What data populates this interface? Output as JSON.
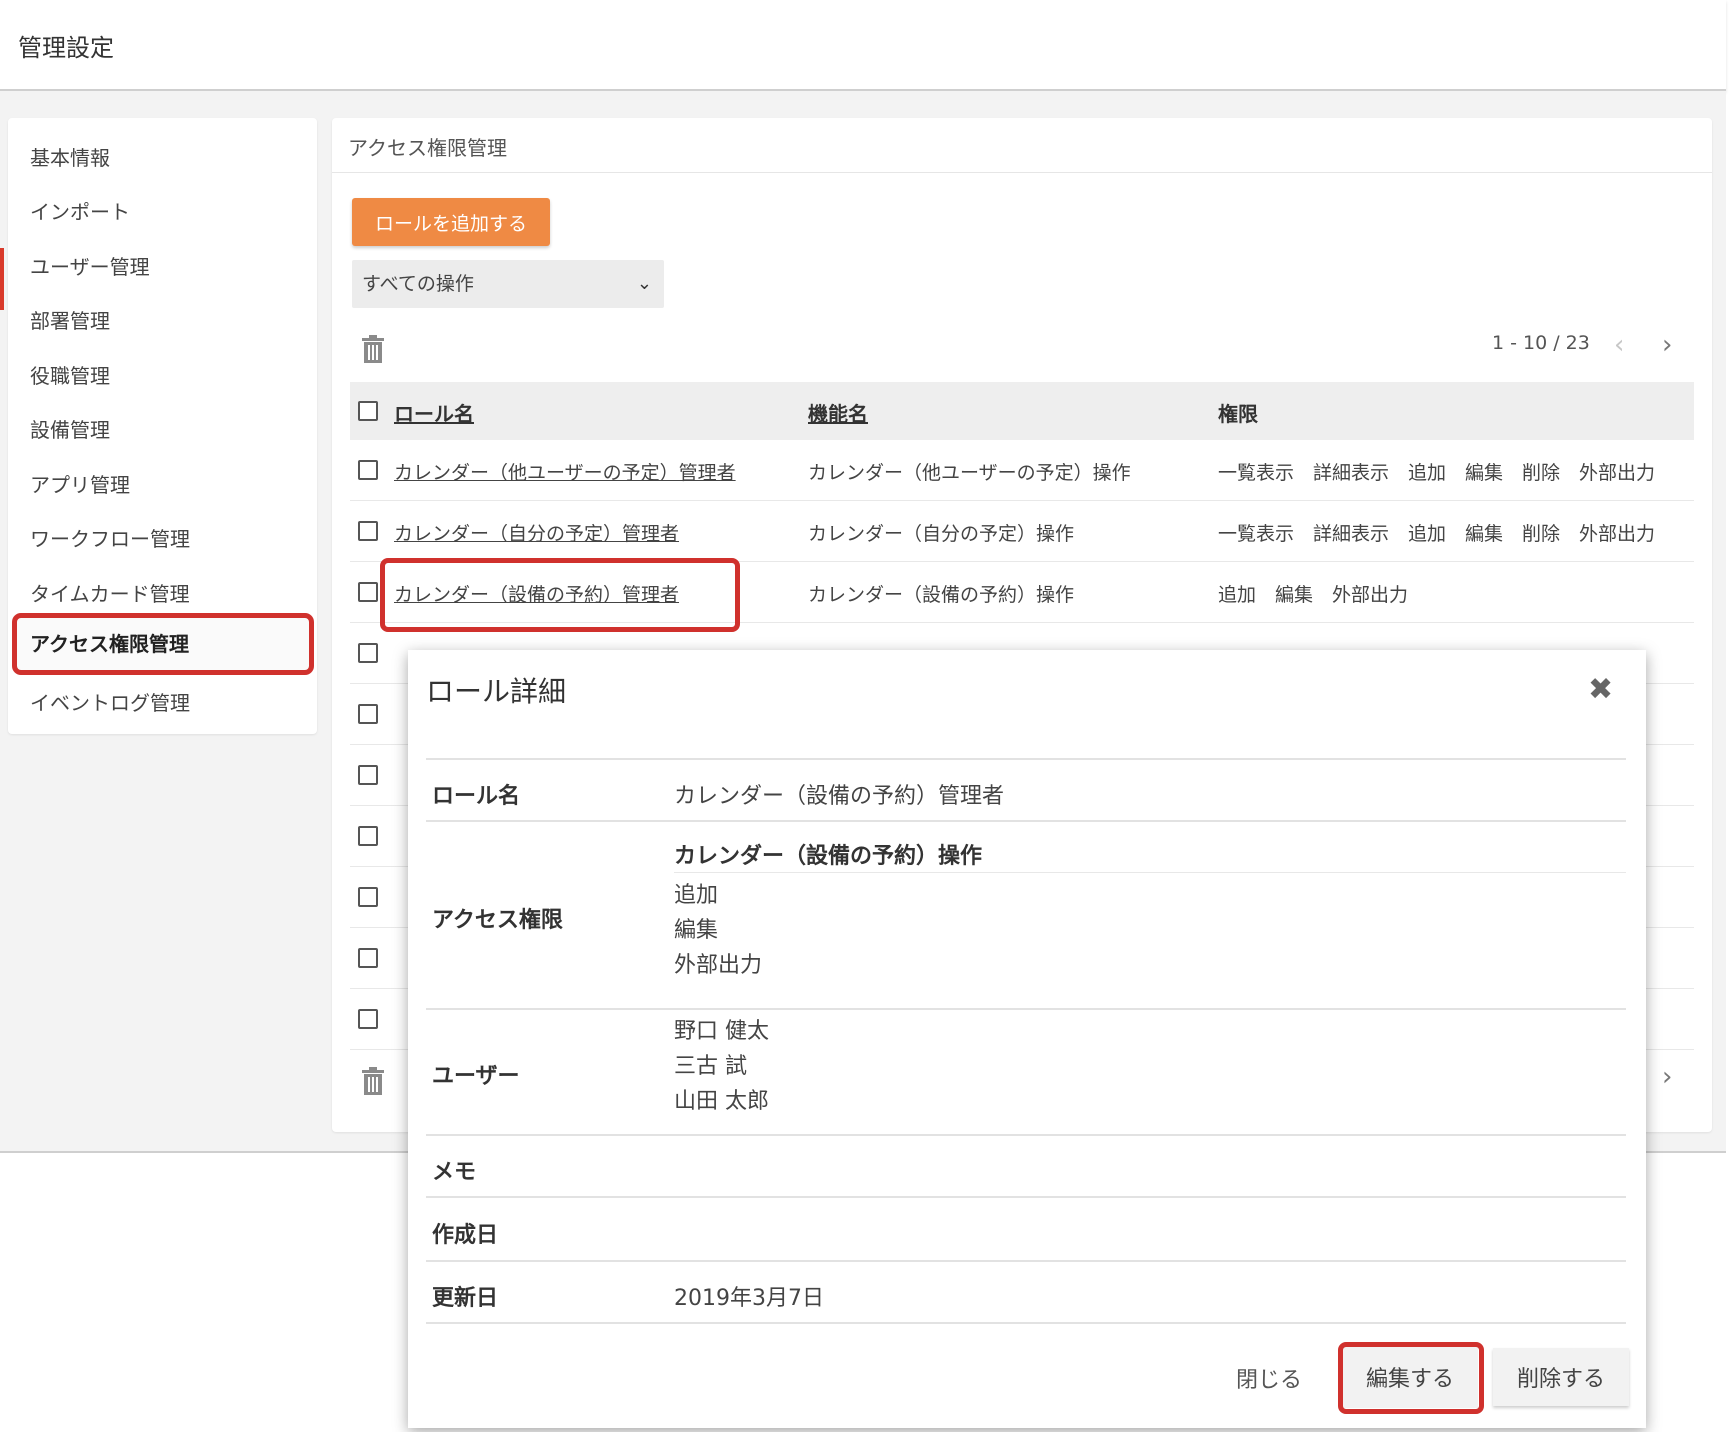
{
  "header": {
    "title": "管理設定"
  },
  "sidebar": {
    "items": [
      {
        "label": "基本情報"
      },
      {
        "label": "インポート"
      },
      {
        "label": "ユーザー管理"
      },
      {
        "label": "部署管理"
      },
      {
        "label": "役職管理"
      },
      {
        "label": "設備管理"
      },
      {
        "label": "アプリ管理"
      },
      {
        "label": "ワークフロー管理"
      },
      {
        "label": "タイムカード管理"
      },
      {
        "label": "アクセス権限管理"
      },
      {
        "label": "イベントログ管理"
      }
    ],
    "active": "アクセス権限管理"
  },
  "main": {
    "title": "アクセス権限管理",
    "add_role_label": "ロールを追加する",
    "filter_selected": "すべての操作",
    "pager": {
      "range": "1 - 10 / 23",
      "prev": "‹",
      "next": "›"
    },
    "columns": {
      "role": "ロール名",
      "feature": "機能名",
      "perm": "権限"
    },
    "rows": [
      {
        "role": "カレンダー（他ユーザーの予定）管理者",
        "feature": "カレンダー（他ユーザーの予定）操作",
        "perm": "一覧表示　詳細表示　追加　編集　削除　外部出力"
      },
      {
        "role": "カレンダー（自分の予定）管理者",
        "feature": "カレンダー（自分の予定）操作",
        "perm": "一覧表示　詳細表示　追加　編集　削除　外部出力"
      },
      {
        "role": "カレンダー（設備の予約）管理者",
        "feature": "カレンダー（設備の予約）操作",
        "perm": "追加　編集　外部出力"
      }
    ]
  },
  "modal": {
    "title": "ロール詳細",
    "close_icon": "✖",
    "role_name_label": "ロール名",
    "role_name": "カレンダー（設備の予約）管理者",
    "access_label": "アクセス権限",
    "access_feature": "カレンダー（設備の予約）操作",
    "access_perms": [
      "追加",
      "編集",
      "外部出力"
    ],
    "user_label": "ユーザー",
    "users": [
      "野口 健太",
      "三古 試",
      "山田 太郎"
    ],
    "memo_label": "メモ",
    "created_label": "作成日",
    "updated_label": "更新日",
    "updated": "2019年3月7日",
    "close_label": "閉じる",
    "edit_label": "編集する",
    "delete_label": "削除する"
  }
}
